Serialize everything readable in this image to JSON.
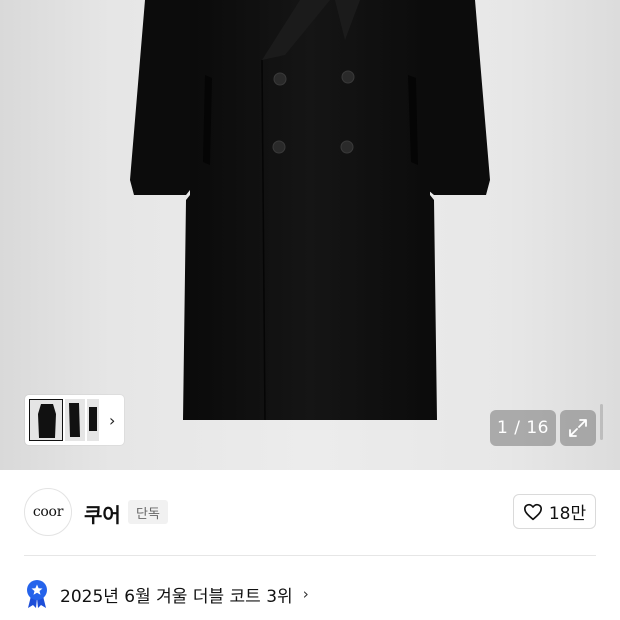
{
  "product_image": {
    "counter": "1 / 16",
    "thumbnails": [
      "coat-front-thumbnail",
      "coat-side-thumbnail",
      "coat-back-thumbnail"
    ]
  },
  "brand": {
    "logo_text": "coor",
    "name": "쿠어",
    "badge": "단독"
  },
  "like": {
    "count": "18만",
    "icon": "heart-icon"
  },
  "ranking": {
    "text": "2025년 6월 겨울 더블 코트 3위",
    "icon": "ribbon-star-icon",
    "accent_color": "#2563eb"
  },
  "colors": {
    "coat": "#0f0f0f",
    "background": "#e8e8e8",
    "overlay": "rgba(120,120,120,0.55)"
  }
}
